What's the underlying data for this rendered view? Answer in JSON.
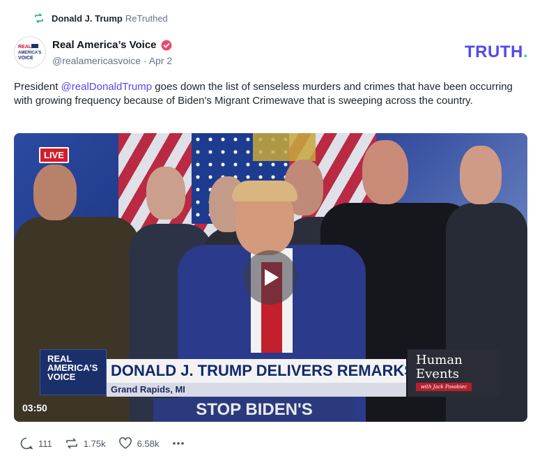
{
  "retruth": {
    "user": "Donald J. Trump",
    "label": "ReTruthed",
    "icon": "retruth-icon"
  },
  "author": {
    "name": "Real America’s Voice",
    "handle": "@realamericasvoice",
    "date": "Apr 2",
    "avatar_text": "REAL AMERICA'S VOICE",
    "verified_icon": "verified-badge-icon"
  },
  "brand": {
    "logo_text": "TRUTH",
    "logo_dot": ".",
    "logo_color": "#5448ee",
    "dot_color": "#3ed2b5"
  },
  "post": {
    "text_before": "President ",
    "mention": "@realDonaldTrump",
    "text_after": " goes down the list of senseless murders and crimes that have been occurring with growing frequency because of Biden's Migrant Crimewave that is sweeping across the country."
  },
  "video": {
    "live_badge": "LIVE",
    "network_logo": "REAL AMERICA'S VOICE",
    "headline": "DONALD J. TRUMP DELIVERS REMARKS",
    "location": "Grand Rapids, MI",
    "partner_logo_line1": "Human",
    "partner_logo_line2": "Events",
    "partner_tag": "with Jack Posobiec",
    "podium_sign": "STOP BIDEN'S",
    "duration": "03:50",
    "play_icon": "play-icon"
  },
  "actions": {
    "replies": "111",
    "retruths": "1.75k",
    "likes": "6.58k",
    "reply_icon": "reply-icon",
    "retruth_icon": "retruth-icon",
    "like_icon": "heart-icon",
    "more_icon": "more-icon"
  }
}
